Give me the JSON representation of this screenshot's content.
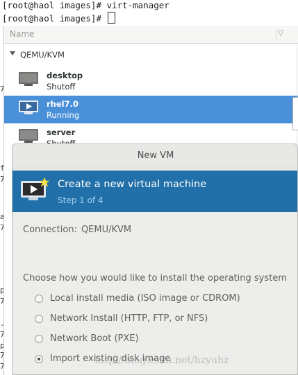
{
  "terminal": {
    "line1": "[root@haol images]# virt-manager",
    "line2": "[root@haol images]# "
  },
  "background_fragments": [
    "7",
    "f",
    "7",
    "a",
    "7",
    "p",
    "7",
    "-",
    "7",
    "p",
    "7",
    "7"
  ],
  "manager": {
    "column_name": "Name",
    "column_sort_indicator": "▽",
    "group": "QEMU/KVM",
    "vms": [
      {
        "name": "desktop",
        "status": "Shutoff",
        "selected": false
      },
      {
        "name": "rhel7.0",
        "status": "Running",
        "selected": true
      },
      {
        "name": "server",
        "status": "Shutoff",
        "selected": false
      }
    ]
  },
  "dialog": {
    "title": "New VM",
    "banner_title": "Create a new virtual machine",
    "banner_step": "Step 1 of 4",
    "connection_label": "Connection:",
    "connection_value": "QEMU/KVM",
    "choose_label": "Choose how you would like to install the operating system",
    "options": [
      {
        "label": "Local install media (ISO image or CDROM)",
        "checked": false
      },
      {
        "label": "Network Install (HTTP, FTP, or NFS)",
        "checked": false
      },
      {
        "label": "Network Boot (PXE)",
        "checked": false
      },
      {
        "label": "Import existing disk image",
        "checked": true
      }
    ]
  },
  "watermark": "http://blog.csdn.net/hzyuhz",
  "colors": {
    "selection": "#4a90d9",
    "banner": "#2170a9",
    "banner_step": "#9fcff0"
  }
}
